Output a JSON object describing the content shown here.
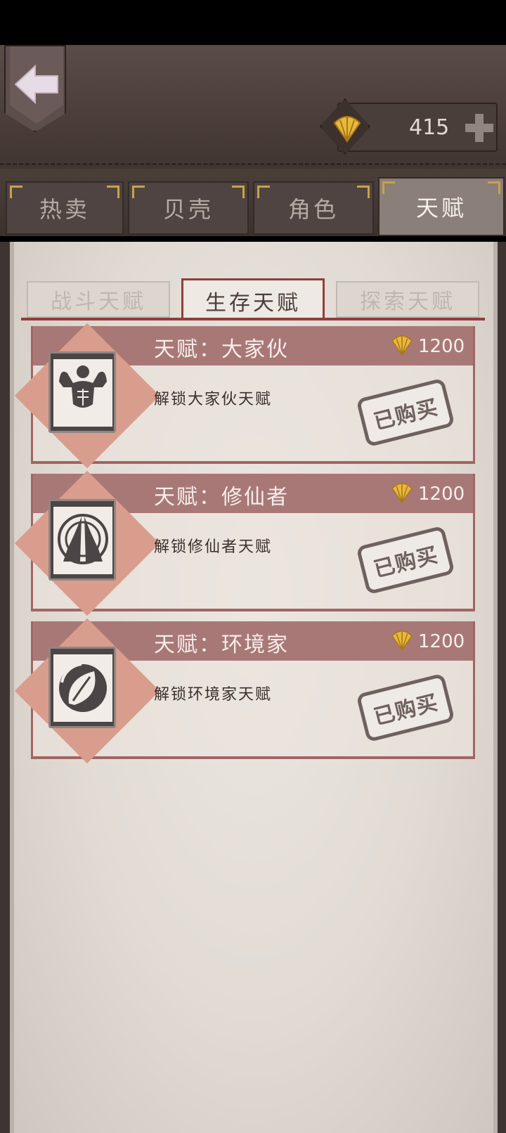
{
  "header": {
    "back_icon": "left-arrow-icon",
    "currency_icon": "shell-icon",
    "currency_amount": "415",
    "add_icon": "plus-icon"
  },
  "tabs": [
    {
      "label": "热卖",
      "active": false
    },
    {
      "label": "贝壳",
      "active": false
    },
    {
      "label": "角色",
      "active": false
    },
    {
      "label": "天赋",
      "active": true
    }
  ],
  "subtabs": [
    {
      "label": "战斗天赋",
      "active": false
    },
    {
      "label": "生存天赋",
      "active": true
    },
    {
      "label": "探索天赋",
      "active": false
    }
  ],
  "talents": [
    {
      "title": "天赋：大家伙",
      "desc": "解锁大家伙天赋",
      "price": "1200",
      "status": "已购买",
      "icon": "muscle-man-icon"
    },
    {
      "title": "天赋：修仙者",
      "desc": "解锁修仙者天赋",
      "price": "1200",
      "status": "已购买",
      "icon": "praying-hands-icon"
    },
    {
      "title": "天赋：环境家",
      "desc": "解锁环境家天赋",
      "price": "1200",
      "status": "已购买",
      "icon": "leaf-recycle-icon"
    }
  ],
  "colors": {
    "accent": "#8e3f3e",
    "card_header": "#a87877",
    "gold": "#e8b93a"
  }
}
